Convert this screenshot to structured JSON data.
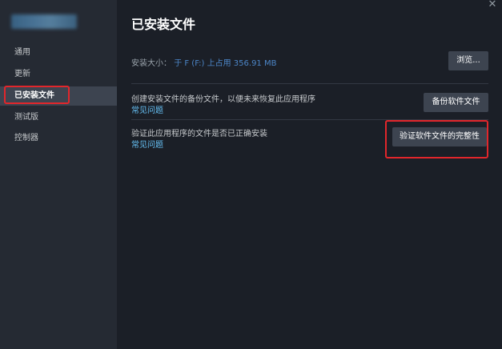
{
  "sidebar": {
    "items": [
      {
        "label": "通用"
      },
      {
        "label": "更新"
      },
      {
        "label": "已安装文件"
      },
      {
        "label": "测试版"
      },
      {
        "label": "控制器"
      }
    ]
  },
  "main": {
    "title": "已安装文件",
    "install_size_label": "安装大小：",
    "install_size_value": "于 F (F:) 上占用 356.91 MB",
    "browse_button": "浏览...",
    "backup_text": "创建安装文件的备份文件，以便未来恢复此应用程序",
    "backup_faq": "常见问题",
    "backup_button": "备份软件文件",
    "verify_text": "验证此应用程序的文件是否已正确安装",
    "verify_faq": "常见问题",
    "verify_button": "验证软件文件的完整性"
  },
  "icons": {
    "close": "close-icon"
  },
  "colors": {
    "highlight": "#e2262b",
    "link": "#66c0f4"
  }
}
